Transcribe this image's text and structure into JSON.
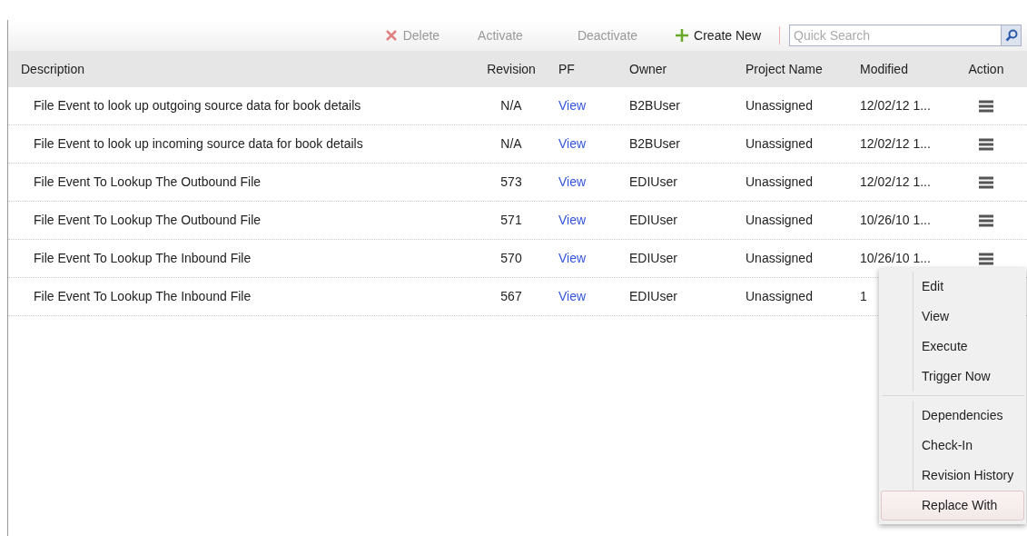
{
  "toolbar": {
    "buttons": [
      {
        "label": "Delete",
        "kind": "delete",
        "disabled": true
      },
      {
        "label": "Activate",
        "kind": "plain",
        "disabled": true
      },
      {
        "label": "Deactivate",
        "kind": "plain",
        "disabled": true
      },
      {
        "label": "Create New",
        "kind": "create",
        "disabled": false
      }
    ],
    "search": {
      "placeholder": "Quick Search"
    }
  },
  "table": {
    "columns": [
      "Description",
      "Revision",
      "PF",
      "Owner",
      "Project Name",
      "Modified",
      "Action"
    ],
    "rows": [
      {
        "description": "File Event to look up outgoing source data for book details",
        "revision": "N/A",
        "pf": "View",
        "owner": "B2BUser",
        "project": "Unassigned",
        "modified": "12/02/12 1..."
      },
      {
        "description": "File Event to look up incoming source data for book details",
        "revision": "N/A",
        "pf": "View",
        "owner": "B2BUser",
        "project": "Unassigned",
        "modified": "12/02/12 1..."
      },
      {
        "description": "File Event To Lookup The Outbound File",
        "revision": "573",
        "pf": "View",
        "owner": "EDIUser",
        "project": "Unassigned",
        "modified": "12/02/12 1..."
      },
      {
        "description": "File Event To Lookup The Outbound File",
        "revision": "571",
        "pf": "View",
        "owner": "EDIUser",
        "project": "Unassigned",
        "modified": "10/26/10 1..."
      },
      {
        "description": "File Event To Lookup The Inbound File",
        "revision": "570",
        "pf": "View",
        "owner": "EDIUser",
        "project": "Unassigned",
        "modified": "10/26/10 1..."
      },
      {
        "description": "File Event To Lookup The Inbound File",
        "revision": "567",
        "pf": "View",
        "owner": "EDIUser",
        "project": "Unassigned",
        "modified": "1"
      }
    ]
  },
  "context_menu": {
    "groups": [
      [
        {
          "label": "Edit",
          "selected": false
        },
        {
          "label": "View",
          "selected": false
        },
        {
          "label": "Execute",
          "selected": false
        },
        {
          "label": "Trigger Now",
          "selected": false
        }
      ],
      [
        {
          "label": "Dependencies",
          "selected": false
        },
        {
          "label": "Check-In",
          "selected": false
        },
        {
          "label": "Revision History",
          "selected": false
        },
        {
          "label": "Replace With",
          "selected": true
        }
      ]
    ]
  }
}
